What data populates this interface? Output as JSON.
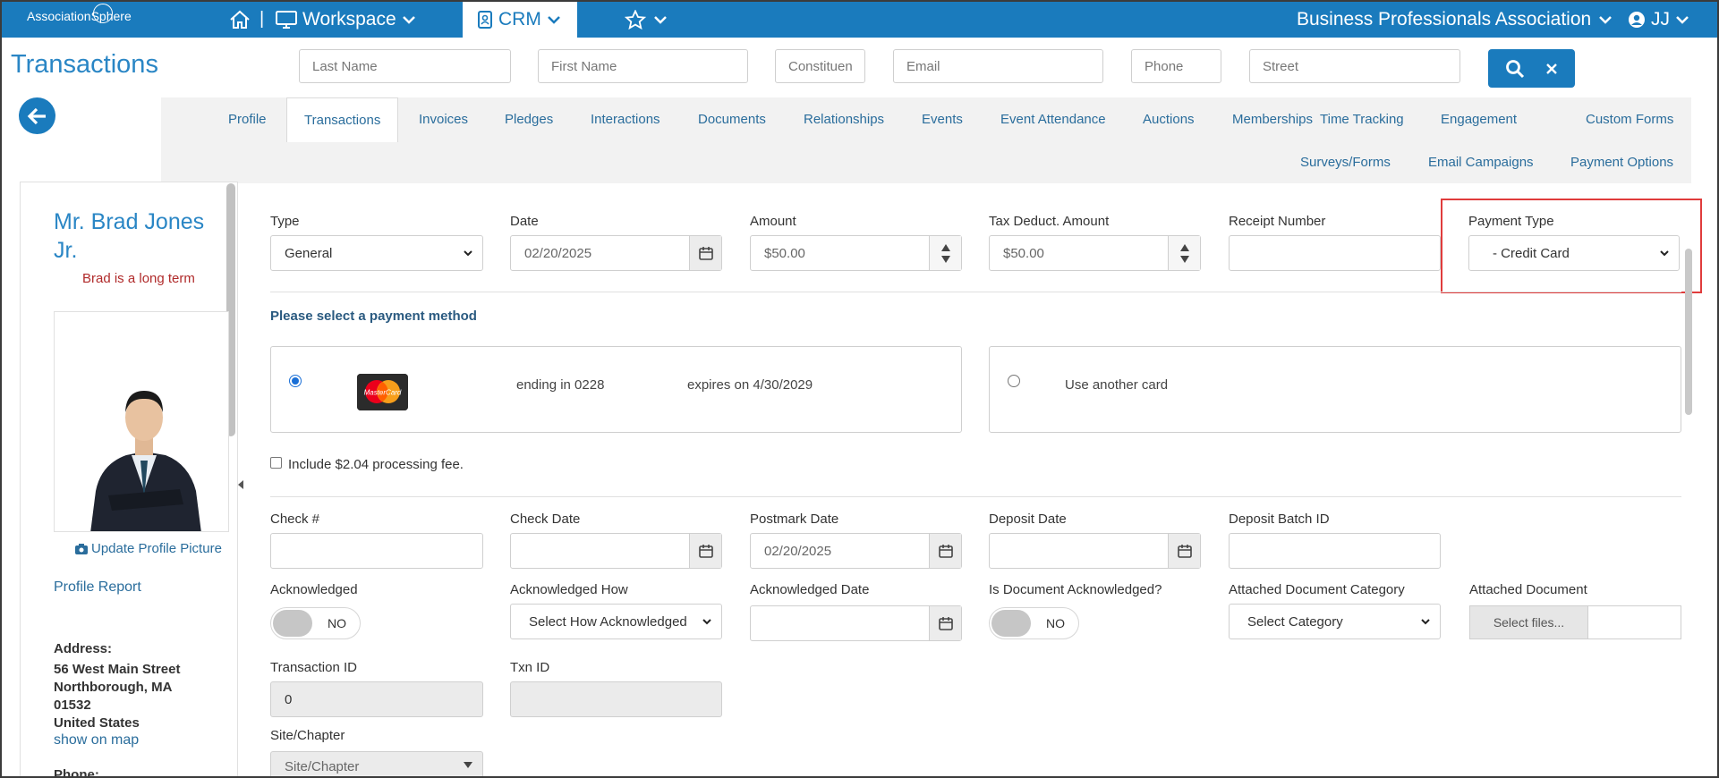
{
  "topbar": {
    "logo": "AssociationSphere",
    "workspace": "Workspace",
    "crm": "CRM",
    "org": "Business Professionals Association",
    "user": "JJ"
  },
  "page": {
    "title": "Transactions"
  },
  "search": {
    "last_name": "Last Name",
    "first_name": "First Name",
    "constituent": "Constituen",
    "email": "Email",
    "phone": "Phone",
    "street": "Street"
  },
  "tabs": {
    "row1": [
      "Profile",
      "Transactions",
      "Invoices",
      "Pledges",
      "Interactions",
      "Documents",
      "Relationships",
      "Events",
      "Event Attendance",
      "Auctions",
      "Memberships",
      "Time Tracking",
      "Engagement",
      "Custom Forms"
    ],
    "row2": [
      "Surveys/Forms",
      "Email Campaigns",
      "Payment Options"
    ]
  },
  "profile": {
    "name": "Mr. Brad Jones Jr.",
    "tagline": "Brad is a long term",
    "update_picture": "Update Profile Picture",
    "profile_report": "Profile Report",
    "address_label": "Address:",
    "address_line1": "56 West Main Street",
    "address_line2": "Northborough, MA",
    "address_line3": "01532",
    "address_line4": "United States",
    "show_on_map": "show on map",
    "phone_label": "Phone:"
  },
  "form": {
    "type_label": "Type",
    "type_value": "General",
    "date_label": "Date",
    "date_value": "02/20/2025",
    "amount_label": "Amount",
    "amount_value": "$50.00",
    "tax_label": "Tax Deduct. Amount",
    "tax_value": "$50.00",
    "receipt_label": "Receipt Number",
    "receipt_value": "",
    "payment_type_label": "Payment Type",
    "payment_type_value": "- Credit Card",
    "payment_method_heading": "Please select a payment method",
    "card_ending": "ending in 0228",
    "card_expires": "expires on 4/30/2029",
    "card_brand": "MasterCard",
    "use_another_card": "Use another card",
    "processing_fee": "Include $2.04 processing fee.",
    "check_label": "Check #",
    "check_date_label": "Check Date",
    "postmark_label": "Postmark Date",
    "postmark_value": "02/20/2025",
    "deposit_date_label": "Deposit Date",
    "deposit_batch_label": "Deposit Batch ID",
    "ack_label": "Acknowledged",
    "ack_value": "NO",
    "ack_how_label": "Acknowledged How",
    "ack_how_value": "Select How Acknowledged",
    "ack_date_label": "Acknowledged Date",
    "doc_ack_label": "Is Document Acknowledged?",
    "doc_ack_value": "NO",
    "doc_cat_label": "Attached Document Category",
    "doc_cat_value": "Select Category",
    "doc_label": "Attached Document",
    "doc_btn": "Select files...",
    "txn_id_label": "Transaction ID",
    "txn_id_value": "0",
    "txnid_label": "Txn ID",
    "site_label": "Site/Chapter",
    "site_value": "Site/Chapter"
  }
}
